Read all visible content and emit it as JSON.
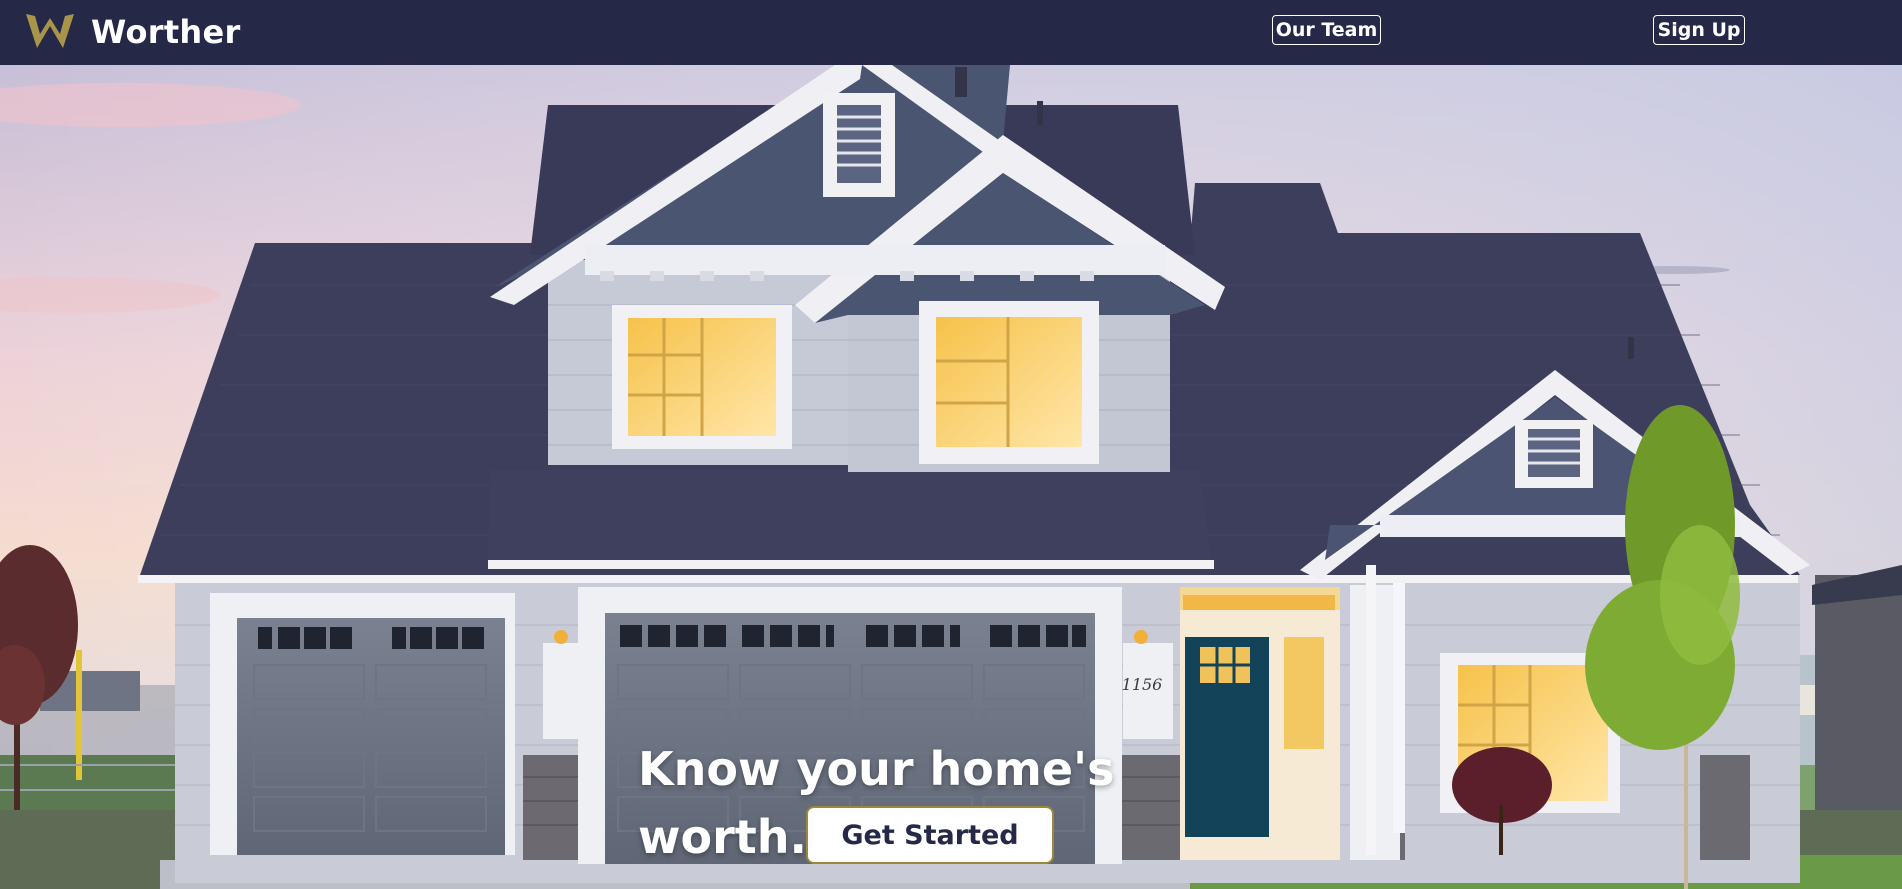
{
  "brand": {
    "name": "Worther",
    "logo_icon": "crown-w-icon",
    "logo_color": "#a8954a"
  },
  "nav": {
    "our_team": "Our Team",
    "sign_up": "Sign Up",
    "background": "#262848"
  },
  "hero": {
    "tagline_line1": "Know your home's",
    "tagline_line2": "worth.",
    "cta_label": "Get Started",
    "cta_border_color": "#9c8838",
    "house_number": "1156"
  }
}
